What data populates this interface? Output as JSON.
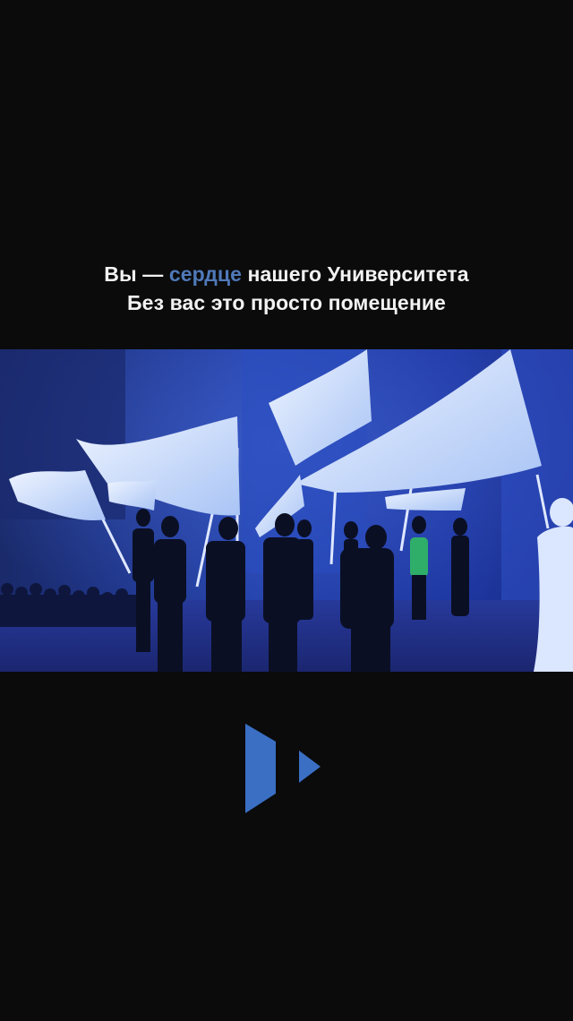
{
  "caption": {
    "line1_before": "Вы — ",
    "line1_accent": "сердце",
    "line1_after": " нашего Университета",
    "line2": "Без вас это просто помещение"
  },
  "video": {
    "icon": "stage-performance-photo"
  },
  "logo": {
    "icon": "play-logo-icon"
  },
  "colors": {
    "background": "#0b0b0c",
    "caption_text": "#f2f2f2",
    "accent": "#4f79b8",
    "logo_blue": "#3a6fc4"
  }
}
